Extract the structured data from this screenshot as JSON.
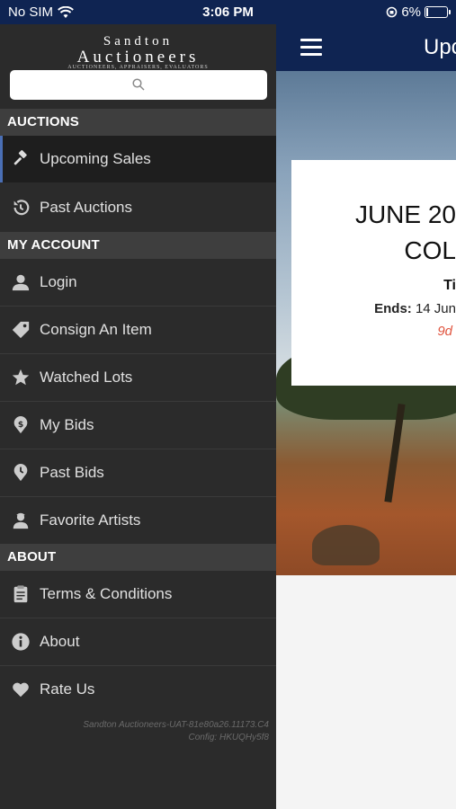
{
  "status_bar": {
    "carrier": "No SIM",
    "time": "3:06 PM",
    "battery": "6%"
  },
  "navbar": {
    "title": "Upc"
  },
  "featured_sale": {
    "title_line1": "JUNE 20",
    "title_line2": "COL",
    "time_label": "Ti",
    "ends_label": "Ends:",
    "ends_value": "14 Jun",
    "time_left": "9d"
  },
  "drawer": {
    "logo": {
      "line1": "Sandton",
      "line2": "Auctioneers",
      "tagline": "AUCTIONEERS, APPRAISERS, EVALUATORS"
    },
    "sections": {
      "auctions": "AUCTIONS",
      "my_account": "MY ACCOUNT",
      "about": "ABOUT"
    },
    "items": {
      "upcoming_sales": "Upcoming Sales",
      "past_auctions": "Past Auctions",
      "login": "Login",
      "consign": "Consign An Item",
      "watched_lots": "Watched Lots",
      "my_bids": "My Bids",
      "past_bids": "Past Bids",
      "favorite_artists": "Favorite Artists",
      "terms": "Terms & Conditions",
      "about": "About",
      "rate_us": "Rate Us"
    },
    "footer": {
      "line1": "Sandton Auctioneers-UAT-81e80a26.11173.C4",
      "line2": "Config: HKUQHy5f8"
    }
  },
  "icons": {
    "search": "search-icon",
    "gavel": "gavel-icon",
    "history": "history-icon",
    "user": "user-icon",
    "tag": "tag-icon",
    "star": "star-icon",
    "bid": "dollar-pin-icon",
    "past_bid": "clock-pin-icon",
    "artist": "artist-icon",
    "clipboard": "clipboard-icon",
    "info": "info-icon",
    "heart": "heart-icon"
  }
}
